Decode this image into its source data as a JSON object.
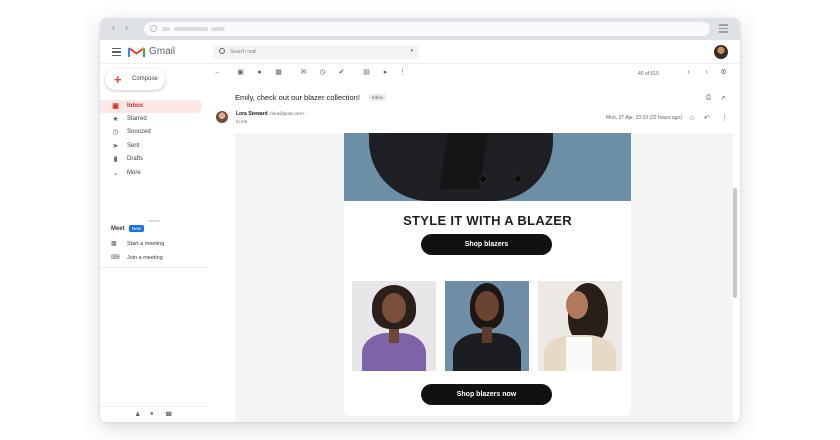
{
  "browser": {
    "back_icon": "chevron-left-icon",
    "forward_icon": "chevron-right-icon",
    "menu_icon": "hamburger-icon"
  },
  "header": {
    "app_name": "Gmail",
    "search_placeholder": "Search mail",
    "brand_colors": {
      "red": "#ea4335",
      "blue": "#4285f4",
      "yellow": "#fbbc04",
      "green": "#34a853"
    }
  },
  "sidebar": {
    "compose_label": "Compose",
    "items": [
      {
        "label": "Inbox",
        "icon": "inbox-icon",
        "active": true
      },
      {
        "label": "Starred",
        "icon": "star-icon",
        "active": false
      },
      {
        "label": "Snoozed",
        "icon": "clock-icon",
        "active": false
      },
      {
        "label": "Sent",
        "icon": "send-icon",
        "active": false
      },
      {
        "label": "Drafts",
        "icon": "draft-icon",
        "active": false
      },
      {
        "label": "More",
        "icon": "chevron-down-icon",
        "active": false
      }
    ],
    "meet": {
      "title": "Meet",
      "badge": "New",
      "items": [
        {
          "label": "Start a meeting",
          "icon": "video-icon"
        },
        {
          "label": "Join a meeting",
          "icon": "keyboard-icon"
        }
      ]
    }
  },
  "toolbar": {
    "count": "40 of 615"
  },
  "message": {
    "subject": "Emily, check out our blazer collection!",
    "label": "Inbox",
    "sender_name": "Lora Steward",
    "sender_email": "<lora@post.com>",
    "to": "to me",
    "date": "Mon, 27 Apr, 23:33 (22 hours ago)"
  },
  "email_body": {
    "heading": "STYLE IT WITH A BLAZER",
    "cta_primary": "Shop blazers",
    "cta_secondary": "Shop blazers now"
  }
}
